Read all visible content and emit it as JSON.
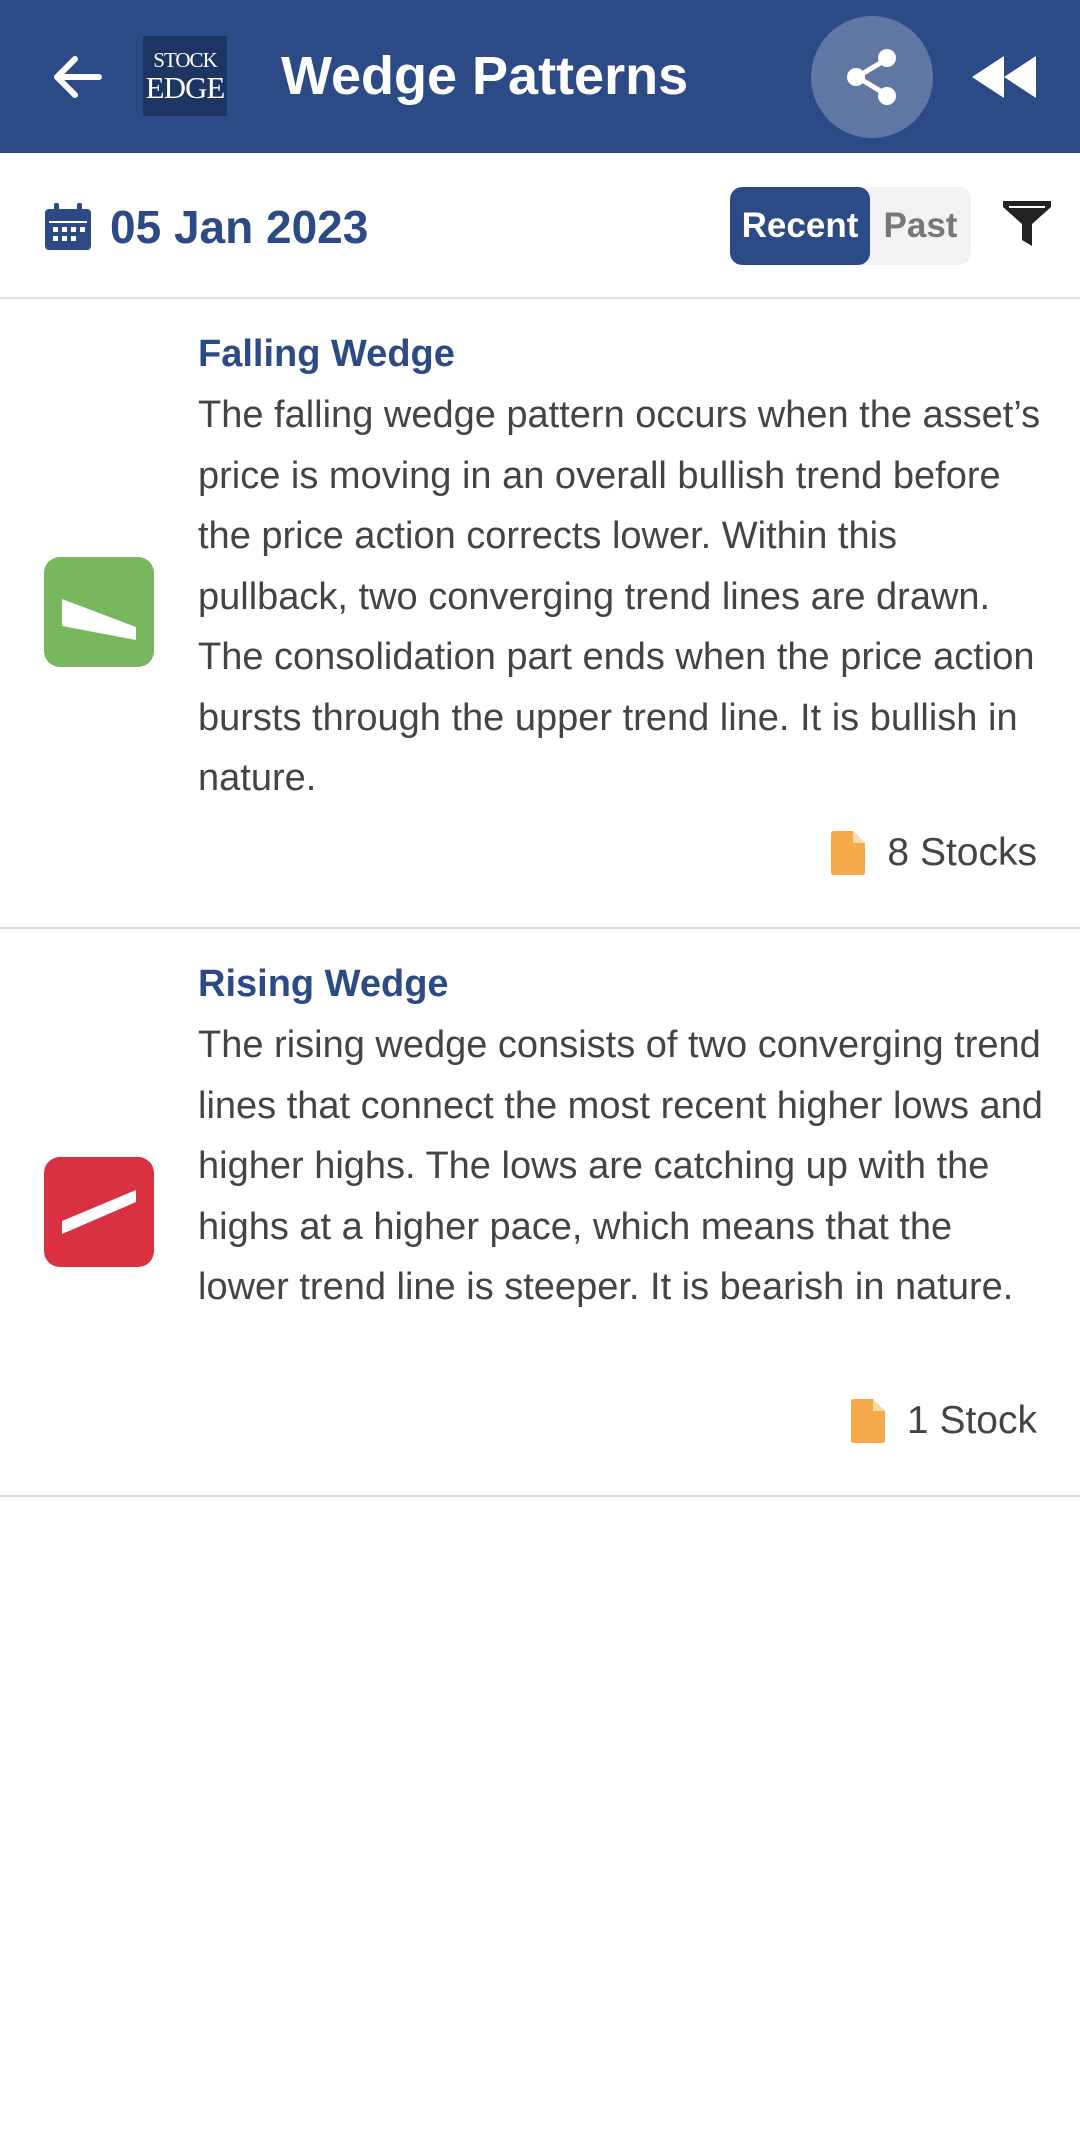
{
  "app_bar": {
    "title": "Wedge Patterns",
    "logo_line1": "STOCK",
    "logo_line2": "EDGE",
    "accent_color": "#2c4a85"
  },
  "icons": {
    "back": "arrow-left-icon",
    "share": "share-icon",
    "rewind": "rewind-icon",
    "calendar": "calendar-icon",
    "filter": "filter-icon",
    "stock_doc": "document-icon"
  },
  "date_bar": {
    "date": "05 Jan 2023",
    "segments": [
      "Recent",
      "Past"
    ],
    "selected_segment": "Recent"
  },
  "patterns": [
    {
      "title": "Falling Wedge",
      "description": "The falling wedge pattern occurs when the asset’s price is moving in an overall bullish trend before the price action corrects lower. Within this pullback, two converging trend lines are drawn. The consolidation part ends when the price action bursts through the upper trend line. It is bullish in nature.",
      "stock_count": "8 Stocks",
      "icon": "falling-wedge-icon",
      "color": "#78b75e"
    },
    {
      "title": "Rising Wedge",
      "description": "The rising wedge consists of two converging trend lines that connect the most recent higher lows and higher highs. The lows are catching up with the highs at a higher pace, which means that the lower trend line is steeper. It is bearish in nature.",
      "stock_count": "1 Stock",
      "icon": "rising-wedge-icon",
      "color": "#d93142"
    }
  ]
}
